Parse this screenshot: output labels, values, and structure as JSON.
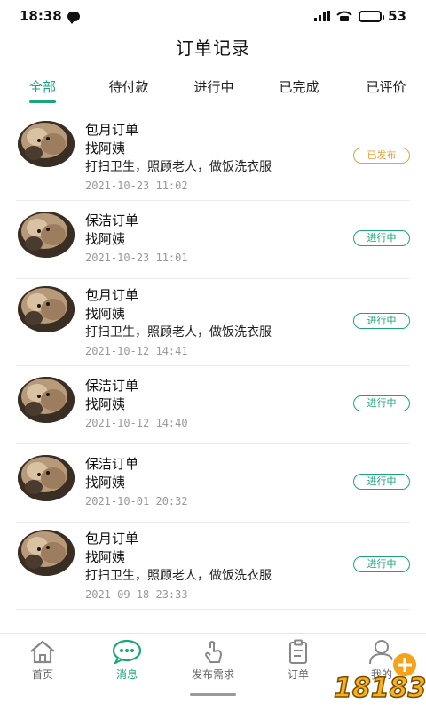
{
  "status_bar": {
    "time": "18:38",
    "battery": "53",
    "battery_level": 0.53
  },
  "header": {
    "title": "订单记录"
  },
  "tabs": [
    {
      "label": "全部",
      "active": true
    },
    {
      "label": "待付款",
      "active": false
    },
    {
      "label": "进行中",
      "active": false
    },
    {
      "label": "已完成",
      "active": false
    },
    {
      "label": "已评价",
      "active": false
    }
  ],
  "orders": [
    {
      "title": "包月订单",
      "subtitle": "找阿姨",
      "desc": "打扫卫生，照顾老人，做饭洗衣服",
      "time": "2021-10-23 11:02",
      "status": "已发布",
      "status_color": "orange"
    },
    {
      "title": "保洁订单",
      "subtitle": "找阿姨",
      "desc": "",
      "time": "2021-10-23 11:01",
      "status": "进行中",
      "status_color": "green"
    },
    {
      "title": "包月订单",
      "subtitle": "找阿姨",
      "desc": "打扫卫生，照顾老人，做饭洗衣服",
      "time": "2021-10-12 14:41",
      "status": "进行中",
      "status_color": "green"
    },
    {
      "title": "保洁订单",
      "subtitle": "找阿姨",
      "desc": "",
      "time": "2021-10-12 14:40",
      "status": "进行中",
      "status_color": "green"
    },
    {
      "title": "保洁订单",
      "subtitle": "找阿姨",
      "desc": "",
      "time": "2021-10-01 20:32",
      "status": "进行中",
      "status_color": "green"
    },
    {
      "title": "包月订单",
      "subtitle": "找阿姨",
      "desc": "打扫卫生，照顾老人，做饭洗衣服",
      "time": "2021-09-18 23:33",
      "status": "进行中",
      "status_color": "green"
    }
  ],
  "bottom_nav": [
    {
      "label": "首页",
      "icon": "home-icon",
      "active": false
    },
    {
      "label": "消息",
      "icon": "message-icon",
      "active": true
    },
    {
      "label": "发布需求",
      "icon": "tap-hand-icon",
      "active": false
    },
    {
      "label": "订单",
      "icon": "clipboard-icon",
      "active": false
    },
    {
      "label": "我的",
      "icon": "user-icon",
      "active": false
    }
  ],
  "watermark": {
    "text": "18183"
  },
  "colors": {
    "accent": "#1aa57c",
    "published": "#e6a23c",
    "muted": "#999999"
  }
}
